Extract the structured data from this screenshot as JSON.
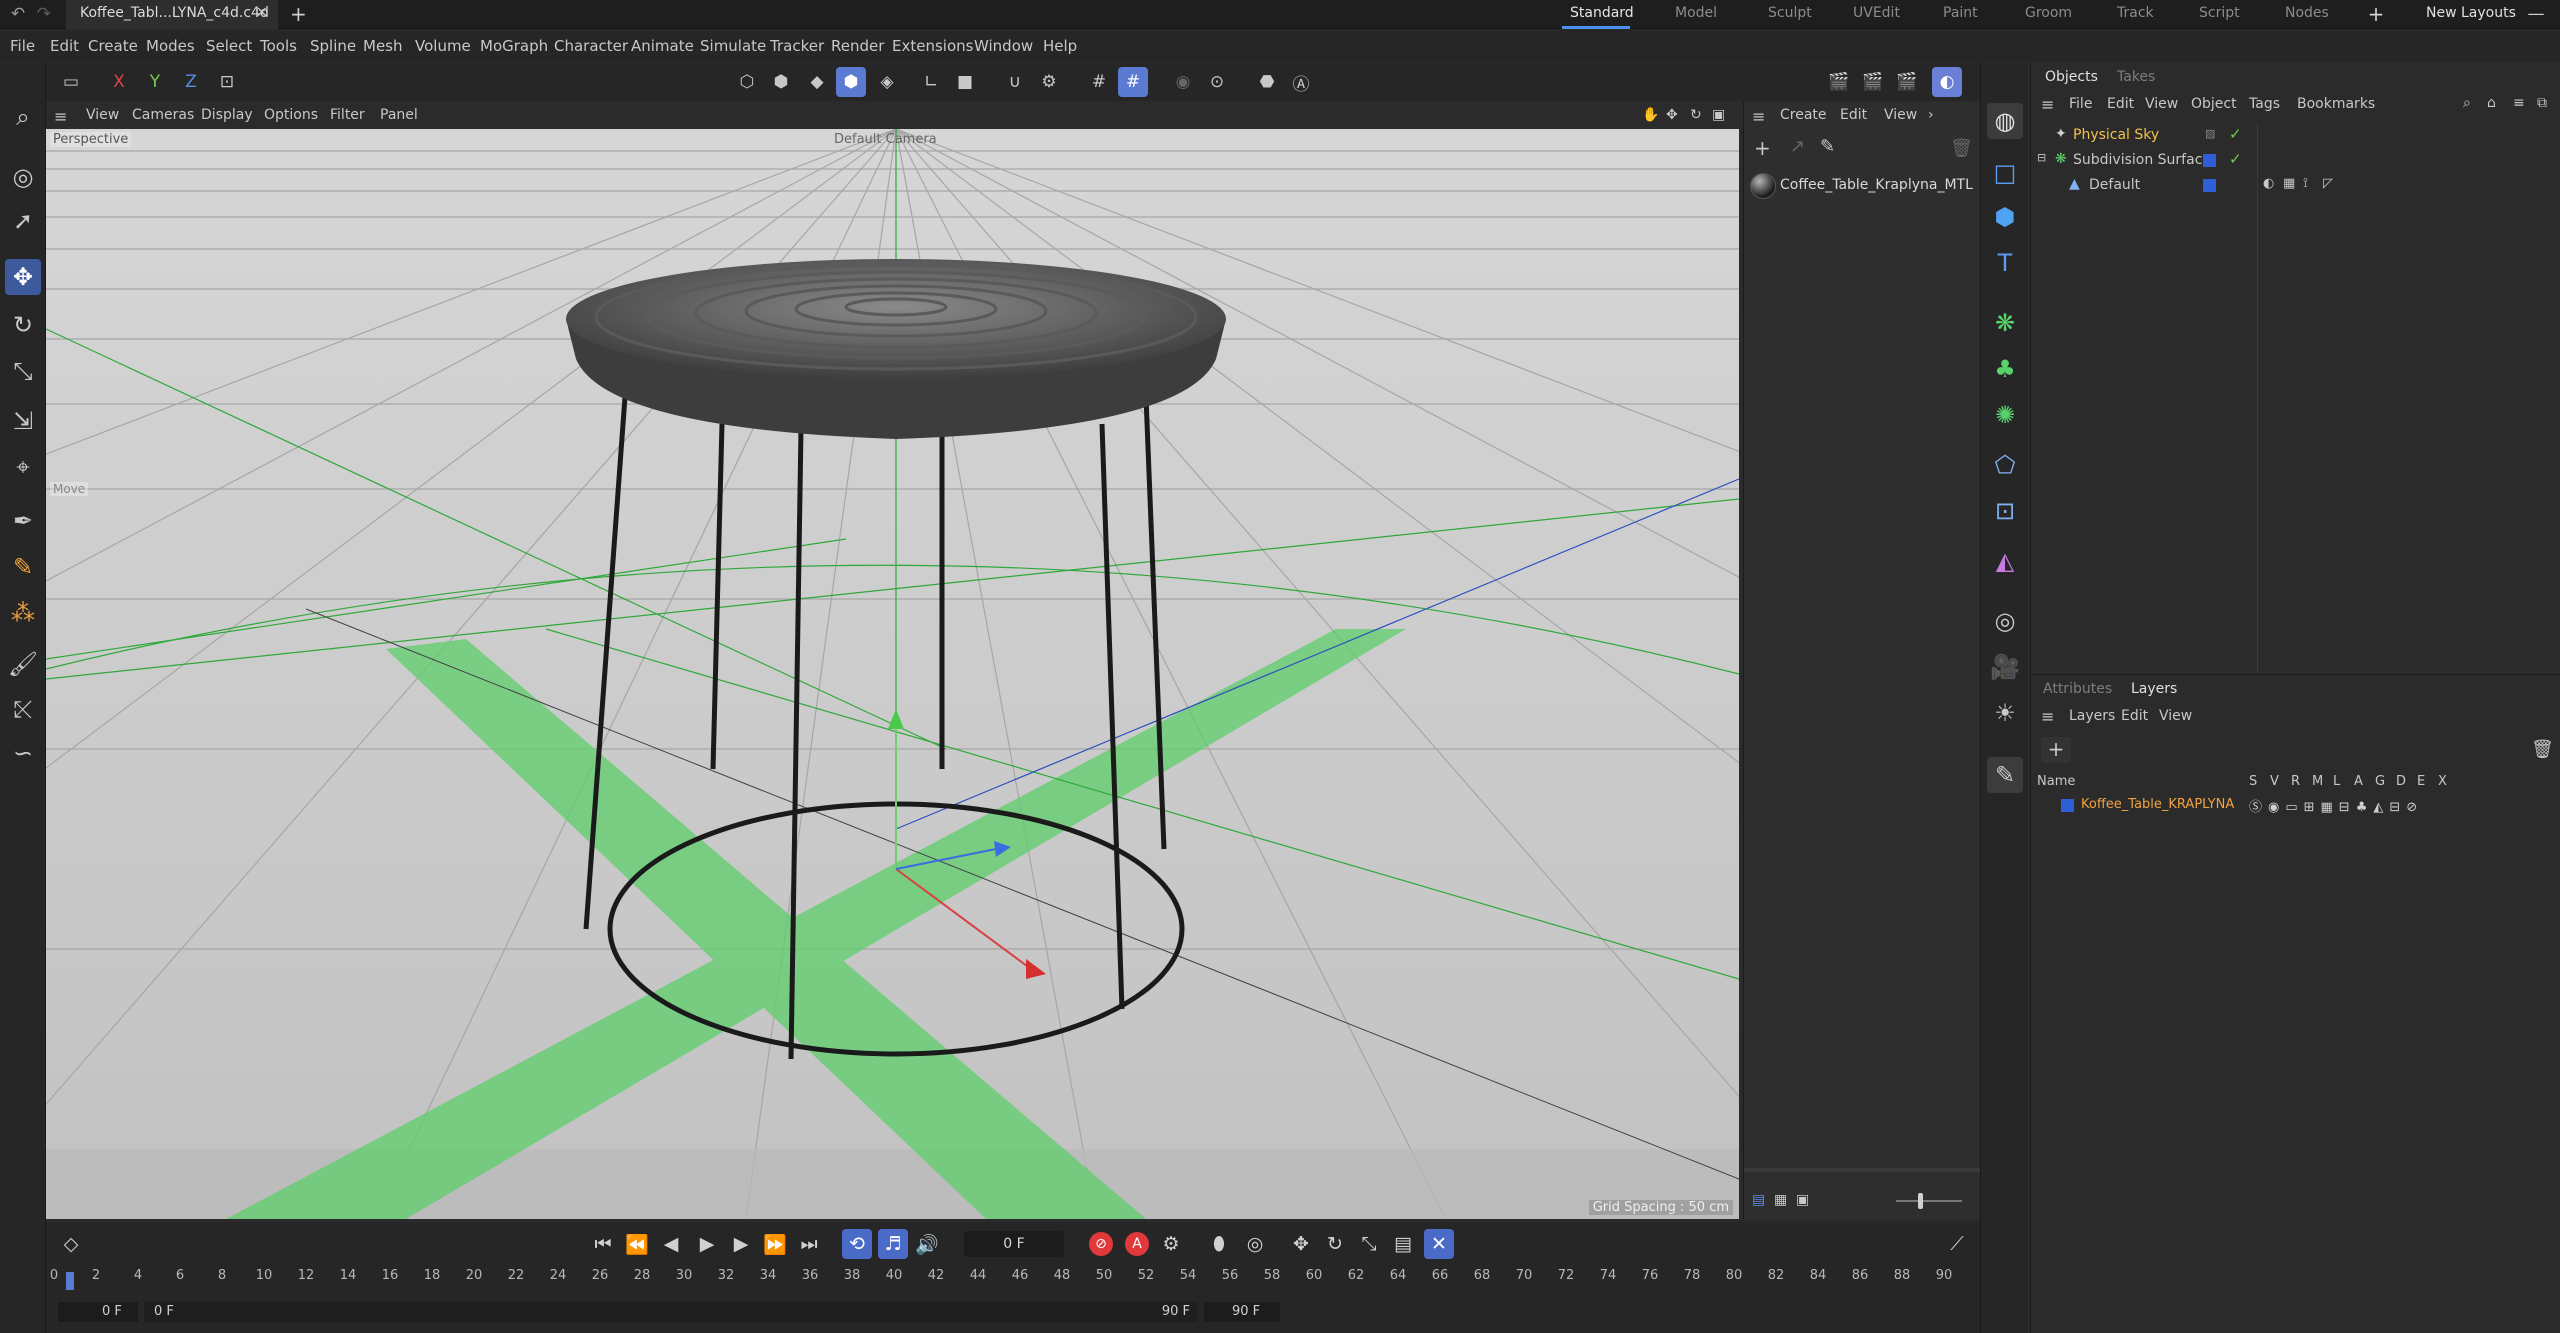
{
  "titlebar": {
    "document_tab": "Koffee_Tabl...LYNA_c4d.c4d",
    "layouts": [
      "Standard",
      "Model",
      "Sculpt",
      "UVEdit",
      "Paint",
      "Groom",
      "Track",
      "Script",
      "Nodes"
    ],
    "active_layout": "Standard",
    "new_layouts": "New Layouts"
  },
  "menubar": {
    "items": [
      "File",
      "Edit",
      "Create",
      "Modes",
      "Select",
      "Tools",
      "Spline",
      "Mesh",
      "Volume",
      "MoGraph",
      "Character",
      "Animate",
      "Simulate",
      "Tracker",
      "Render",
      "Extensions",
      "Window",
      "Help"
    ]
  },
  "toolstrip": {
    "x_label": "X",
    "y_label": "Y",
    "z_label": "Z"
  },
  "viewport": {
    "menus": [
      "View",
      "Cameras",
      "Display",
      "Options",
      "Filter",
      "Panel"
    ],
    "projection": "Perspective",
    "camera": "Default Camera",
    "tool_label": "Move",
    "grid_spacing": "Grid Spacing : 50 cm"
  },
  "material_panel": {
    "menus": [
      "Create",
      "Edit",
      "View"
    ],
    "material_name": "Coffee_Table_Kraplyna_MTL"
  },
  "objects_panel": {
    "tabs": [
      "Objects",
      "Takes"
    ],
    "active_tab": "Objects",
    "menus": [
      "File",
      "Edit",
      "View",
      "Object",
      "Tags",
      "Bookmarks"
    ],
    "objects": [
      {
        "name": "Physical Sky",
        "color": "#f2c04b",
        "indent": 0
      },
      {
        "name": "Subdivision Surface",
        "color": "#c8c8c8",
        "indent": 0
      },
      {
        "name": "Default",
        "color": "#c8c8c8",
        "indent": 1
      }
    ]
  },
  "layers_panel": {
    "tabs": [
      "Attributes",
      "Layers"
    ],
    "active_tab": "Layers",
    "menus": [
      "Layers",
      "Edit",
      "View"
    ],
    "column_name": "Name",
    "columns": [
      "S",
      "V",
      "R",
      "M",
      "L",
      "A",
      "G",
      "D",
      "E",
      "X"
    ],
    "layer": {
      "name": "Koffee_Table_KRAPLYNA",
      "color": "#2f5fd6",
      "text_color": "#f2a341"
    }
  },
  "timeline": {
    "current_frame": "0 F",
    "ticks": [
      0,
      2,
      4,
      6,
      8,
      10,
      12,
      14,
      16,
      18,
      20,
      22,
      24,
      26,
      28,
      30,
      32,
      34,
      36,
      38,
      40,
      42,
      44,
      46,
      48,
      50,
      52,
      54,
      56,
      58,
      60,
      62,
      64,
      66,
      68,
      70,
      72,
      74,
      76,
      78,
      80,
      82,
      84,
      86,
      88,
      90
    ],
    "start_frame": "0 F",
    "preview_start": "0 F",
    "preview_end": "90 F",
    "end_frame": "90 F"
  },
  "colors": {
    "accent_blue": "#4b8ff0",
    "active_button": "#3d5a9c",
    "record_red": "#e0383b",
    "axis_green": "#7acb52"
  }
}
